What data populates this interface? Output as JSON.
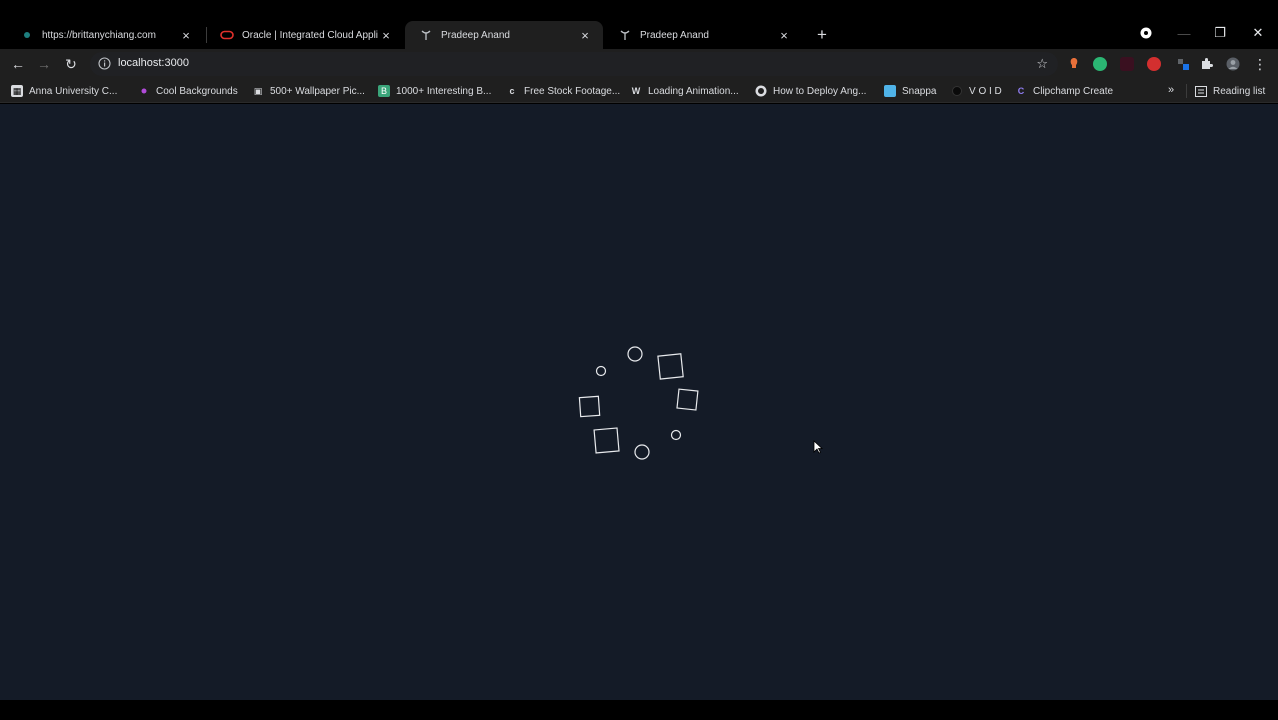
{
  "tabs": [
    {
      "title": "https://brittanychiang.com",
      "favicon": "dot-icon",
      "active": false
    },
    {
      "title": "Oracle | Integrated Cloud Applic...",
      "favicon": "oracle-icon",
      "active": false
    },
    {
      "title": "Pradeep Anand",
      "favicon": "antenna-icon",
      "active": true
    },
    {
      "title": "Pradeep Anand",
      "favicon": "antenna-icon",
      "active": false
    }
  ],
  "tab_close_glyph": "×",
  "new_tab_glyph": "+",
  "window_controls": {
    "minimize": "—",
    "restore": "❐",
    "close": "✕"
  },
  "toolbar": {
    "back": "←",
    "forward": "→",
    "reload": "↻",
    "url": "localhost:3000",
    "bookmark_star": "☆",
    "menu": "⋮"
  },
  "bookmarks": [
    {
      "label": "Anna University   C...",
      "icon": "au-icon"
    },
    {
      "label": "Cool Backgrounds",
      "icon": "dot-icon"
    },
    {
      "label": "500+ Wallpaper Pic...",
      "icon": "camera-icon"
    },
    {
      "label": "1000+ Interesting B...",
      "icon": "book-icon"
    },
    {
      "label": "Free Stock Footage...",
      "icon": "c-icon"
    },
    {
      "label": "Loading Animation...",
      "icon": "w-icon"
    },
    {
      "label": "How to Deploy Ang...",
      "icon": "github-icon"
    },
    {
      "label": "Snappa",
      "icon": "snappa-icon"
    },
    {
      "label": "V O I D",
      "icon": "void-icon"
    },
    {
      "label": "Clipchamp Create",
      "icon": "clipchamp-icon"
    }
  ],
  "bookmarks_overflow": "»",
  "reading_list": "Reading list",
  "colors": {
    "page_background": "#141b27",
    "tab_strip": "#000000",
    "toolbar": "#1f1f1f",
    "spinner_stroke": "#e8eaed"
  },
  "loader": {
    "shapes": [
      "circle",
      "circle",
      "square",
      "square",
      "square",
      "square",
      "circle",
      "circle"
    ]
  }
}
